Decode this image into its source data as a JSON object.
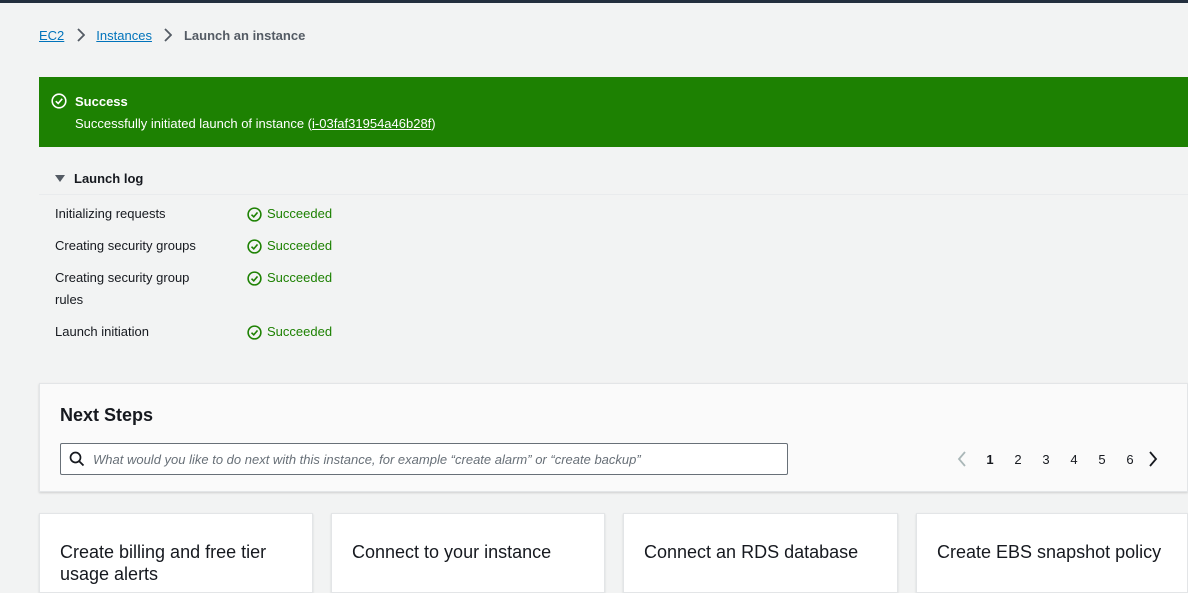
{
  "breadcrumb": {
    "items": [
      "EC2",
      "Instances"
    ],
    "current": "Launch an instance"
  },
  "flash": {
    "type": "success",
    "color": "#1d8102",
    "title": "Success",
    "message_prefix": "Successfully initiated launch of instance (",
    "instance_id": "i-03faf31954a46b28f",
    "message_suffix": ")",
    "icon": "check-circle-icon"
  },
  "launch_log": {
    "label": "Launch log",
    "expanded": true,
    "steps": [
      {
        "label": "Initializing requests",
        "status": "Succeeded"
      },
      {
        "label": "Creating security groups",
        "status": "Succeeded"
      },
      {
        "label": "Creating security group rules",
        "status": "Succeeded"
      },
      {
        "label": "Launch initiation",
        "status": "Succeeded"
      }
    ]
  },
  "next_steps": {
    "title": "Next Steps",
    "search_placeholder": "What would you like to do next with this instance, for example “create alarm” or “create backup”",
    "pagination": {
      "pages": [
        "1",
        "2",
        "3",
        "4",
        "5",
        "6"
      ],
      "current": "1"
    },
    "cards": [
      {
        "title": "Create billing and free tier usage alerts"
      },
      {
        "title": "Connect to your instance"
      },
      {
        "title": "Connect an RDS database"
      },
      {
        "title": "Create EBS snapshot policy"
      }
    ]
  }
}
